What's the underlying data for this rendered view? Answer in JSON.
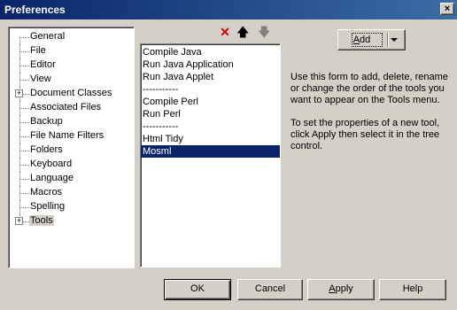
{
  "window": {
    "title": "Preferences",
    "close_glyph": "×"
  },
  "tree": {
    "items": [
      {
        "label": "General",
        "expandable": false
      },
      {
        "label": "File",
        "expandable": false
      },
      {
        "label": "Editor",
        "expandable": false
      },
      {
        "label": "View",
        "expandable": false
      },
      {
        "label": "Document Classes",
        "expandable": true
      },
      {
        "label": "Associated Files",
        "expandable": false
      },
      {
        "label": "Backup",
        "expandable": false
      },
      {
        "label": "File Name Filters",
        "expandable": false
      },
      {
        "label": "Folders",
        "expandable": false
      },
      {
        "label": "Keyboard",
        "expandable": false
      },
      {
        "label": "Language",
        "expandable": false
      },
      {
        "label": "Macros",
        "expandable": false
      },
      {
        "label": "Spelling",
        "expandable": false
      },
      {
        "label": "Tools",
        "expandable": true,
        "selected": true
      }
    ],
    "expander_glyph": "+"
  },
  "toolbar": {
    "delete_icon": "delete-icon",
    "delete_color": "#cc0000",
    "move_up_icon": "arrow-up-icon",
    "move_down_icon": "arrow-down-icon",
    "delete_glyph": "✕",
    "up_glyph": "🡅",
    "down_glyph": "🡇"
  },
  "tools_list": {
    "items": [
      "Compile Java",
      "Run Java Application",
      "Run Java Applet",
      "-----------",
      "Compile Perl",
      "Run Perl",
      "-----------",
      "Html Tidy",
      "Mosml"
    ],
    "selected_index": 8
  },
  "add_button": {
    "label": "Add",
    "accel": "A",
    "rest": "dd"
  },
  "info": {
    "paragraph1": "Use this form to add, delete, rename or change the order of the tools you want to appear on the Tools menu.",
    "paragraph2": "To set the properties of a new tool, click Apply then select it in the tree control."
  },
  "buttons": {
    "ok": "OK",
    "cancel": "Cancel",
    "apply_accel": "A",
    "apply_rest": "pply",
    "help": "Help"
  },
  "colors": {
    "selection": "#0a246a",
    "face": "#d4d0c8"
  }
}
